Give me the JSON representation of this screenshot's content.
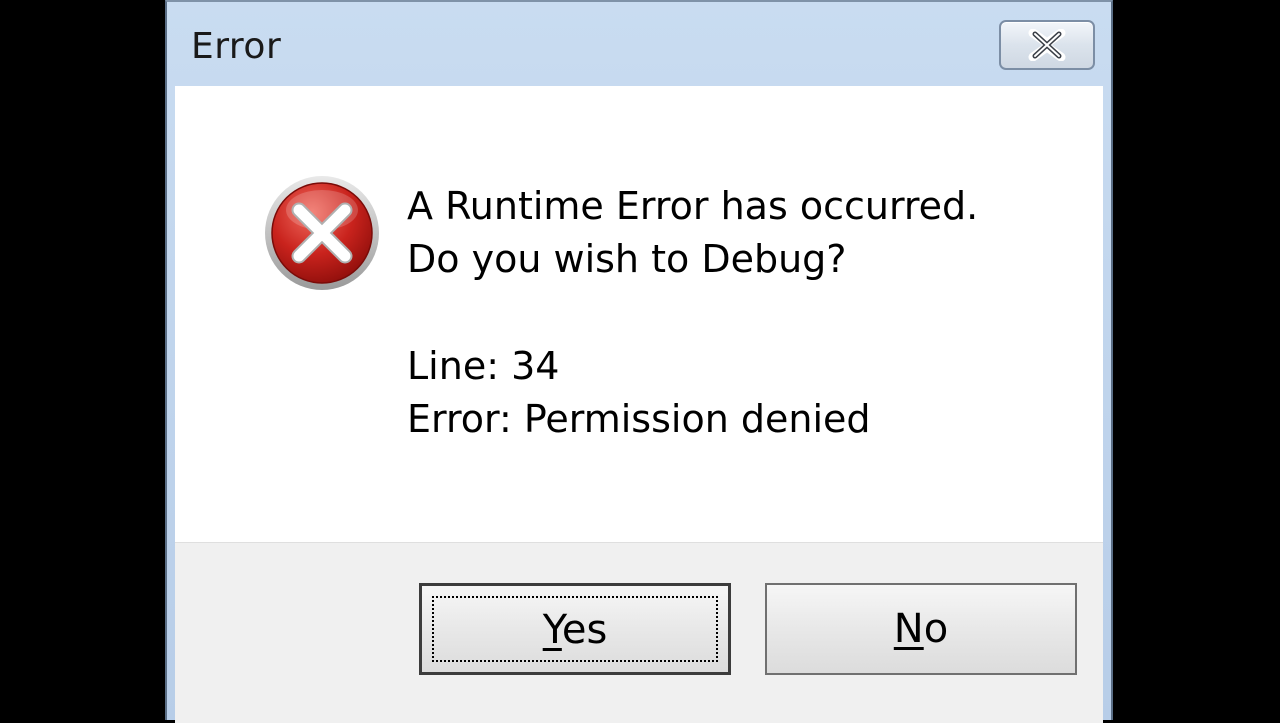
{
  "window": {
    "title": "Error",
    "close_icon": "close-icon"
  },
  "message": {
    "icon": "error-icon",
    "line1": "A Runtime Error has occurred.",
    "line2": "Do you wish to Debug?",
    "line3": "Line: 34",
    "line4": "Error: Permission denied"
  },
  "buttons": {
    "yes_mnemonic": "Y",
    "yes_rest": "es",
    "no_mnemonic": "N",
    "no_rest": "o"
  },
  "colors": {
    "title_bar": "#c9dcf1",
    "error_red": "#c0201c",
    "footer": "#f0f0f0"
  }
}
